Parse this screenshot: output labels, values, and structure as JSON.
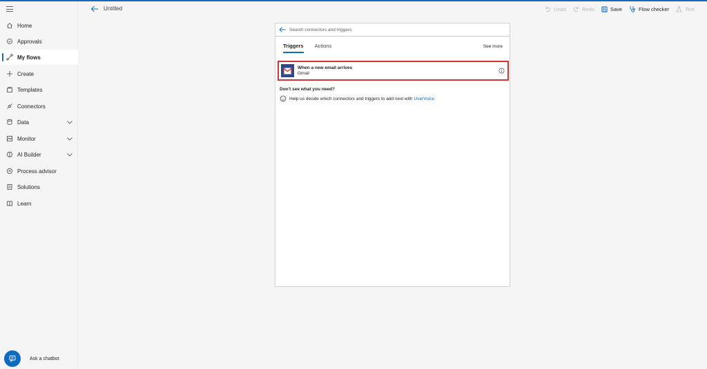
{
  "header": {
    "title": "Untitled"
  },
  "toolbar": {
    "undo": "Undo",
    "redo": "Redo",
    "save": "Save",
    "flow_checker": "Flow checker",
    "test": "Test"
  },
  "sidebar": {
    "items": [
      {
        "label": "Home",
        "icon": "home-icon"
      },
      {
        "label": "Approvals",
        "icon": "approvals-icon"
      },
      {
        "label": "My flows",
        "icon": "flows-icon",
        "active": true
      },
      {
        "label": "Create",
        "icon": "plus-icon"
      },
      {
        "label": "Templates",
        "icon": "templates-icon"
      },
      {
        "label": "Connectors",
        "icon": "connectors-icon"
      },
      {
        "label": "Data",
        "icon": "data-icon",
        "expandable": true
      },
      {
        "label": "Monitor",
        "icon": "monitor-icon",
        "expandable": true
      },
      {
        "label": "AI Builder",
        "icon": "ai-builder-icon",
        "expandable": true
      },
      {
        "label": "Process advisor",
        "icon": "process-advisor-icon"
      },
      {
        "label": "Solutions",
        "icon": "solutions-icon"
      },
      {
        "label": "Learn",
        "icon": "learn-icon"
      }
    ],
    "chatbot_label": "Ask a chatbot"
  },
  "panel": {
    "search_placeholder": "Search connectors and triggers",
    "tabs": [
      {
        "label": "Triggers",
        "active": true
      },
      {
        "label": "Actions",
        "active": false
      }
    ],
    "see_more": "See more",
    "trigger": {
      "title": "When a new email arrives",
      "connector": "Gmail"
    },
    "dont_see": "Don't see what you need?",
    "help_text": "Help us decide which connectors and triggers to add next with",
    "help_link": "UserVoice"
  },
  "colors": {
    "accent": "#0f6cbd",
    "highlight": "#d13438",
    "gmail_tile": "#2c4a8a"
  }
}
